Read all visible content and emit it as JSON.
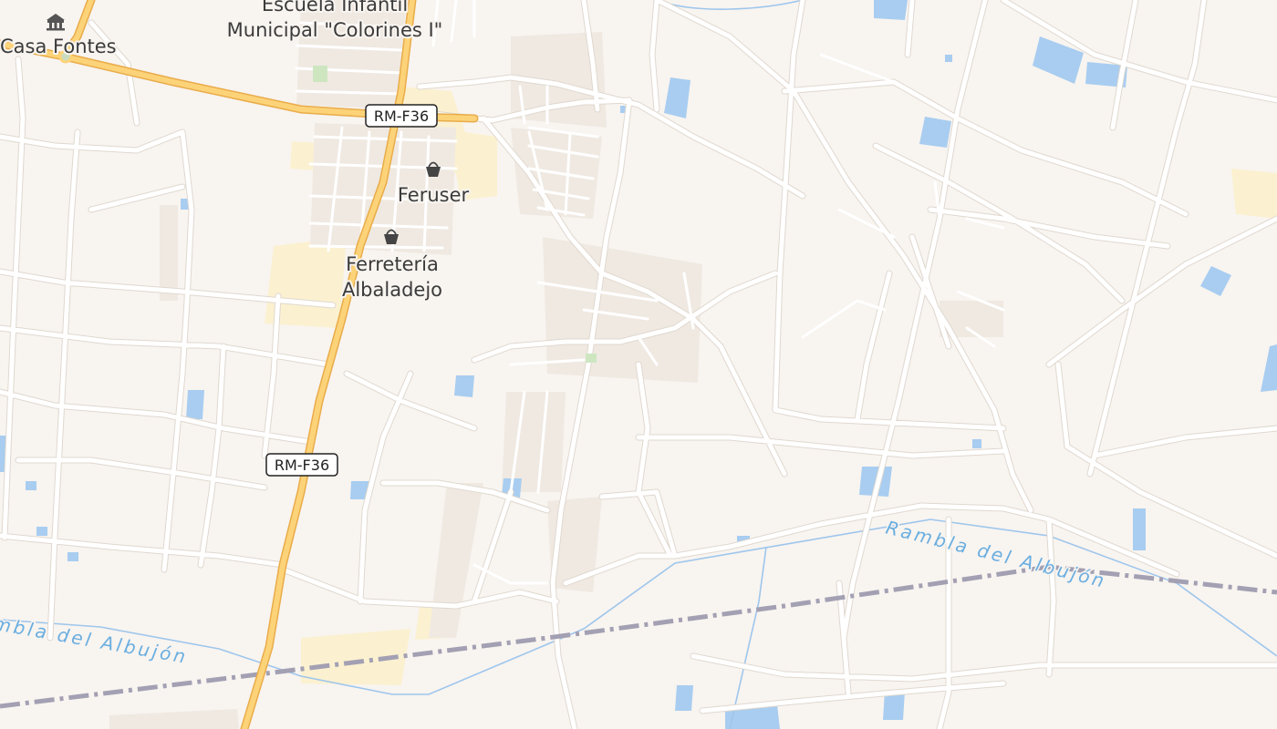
{
  "map": {
    "places": [
      {
        "id": "casa-fontes",
        "label": "Casa Fontes",
        "icon": "museum-icon"
      },
      {
        "id": "escuela",
        "lines": [
          "Escuela Infantil",
          "Municipal \"Colorines I\""
        ]
      },
      {
        "id": "feruser",
        "label": "Feruser",
        "icon": "shop-basket-icon"
      },
      {
        "id": "ferreteria",
        "lines": [
          "Ferretería",
          "Albaladejo"
        ],
        "icon": "shop-basket-icon"
      }
    ],
    "road_shields": [
      "RM-F36",
      "RM-F36"
    ],
    "waterways": [
      "Rambla del Albujón",
      "Rambla del Albujón"
    ],
    "colors": {
      "background": "#f8f4f0",
      "minor_road": "#ffffff",
      "primary_road": "#fcd379",
      "primary_casing": "#e9ac4a",
      "water": "#a8cdf0",
      "waterway": "#9ec6ec",
      "railway": "#a3a0b3",
      "residential": "#efe9e1",
      "commercial": "#fbf1d0"
    }
  }
}
